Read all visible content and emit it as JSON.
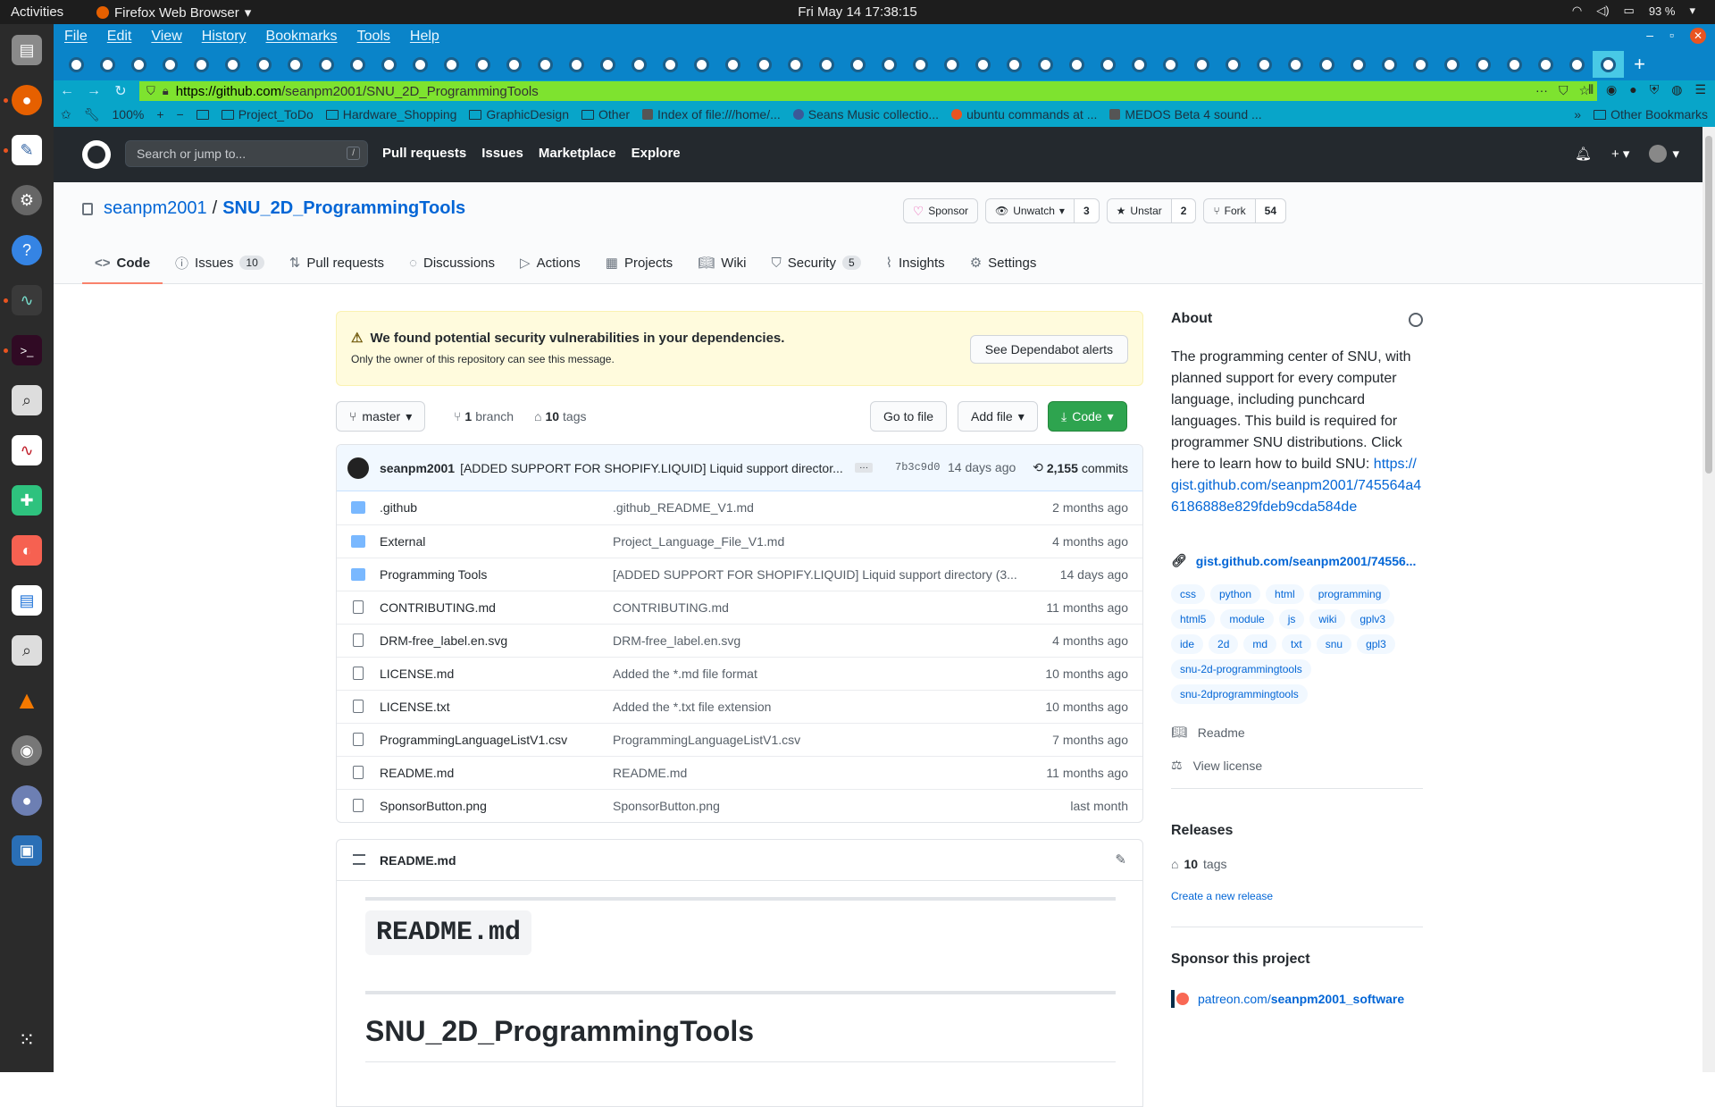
{
  "desktop": {
    "activities": "Activities",
    "app_name": "Firefox Web Browser",
    "clock": "Fri May 14  17:38:15",
    "battery": "93 %"
  },
  "menu": [
    "File",
    "Edit",
    "View",
    "History",
    "Bookmarks",
    "Tools",
    "Help"
  ],
  "url": {
    "domain": "https://github.com",
    "path": "/seanpm2001/SNU_2D_ProgrammingTools"
  },
  "bookmarks": {
    "zoom": "100%",
    "items": [
      "Project_ToDo",
      "Hardware_Shopping",
      "GraphicDesign",
      "Other",
      "Index of file:///home/...",
      "Seans Music collectio...",
      "ubuntu commands at ...",
      "MEDOS Beta 4 sound ..."
    ],
    "other": "Other Bookmarks"
  },
  "gh": {
    "search_placeholder": "Search or jump to...",
    "nav": [
      "Pull requests",
      "Issues",
      "Marketplace",
      "Explore"
    ]
  },
  "repo": {
    "owner": "seanpm2001",
    "name": "SNU_2D_ProgrammingTools",
    "sponsor": "Sponsor",
    "unwatch": "Unwatch",
    "watch_count": "3",
    "unstar": "Unstar",
    "star_count": "2",
    "fork": "Fork",
    "fork_count": "54",
    "tabs": [
      {
        "label": "Code",
        "count": ""
      },
      {
        "label": "Issues",
        "count": "10"
      },
      {
        "label": "Pull requests",
        "count": ""
      },
      {
        "label": "Discussions",
        "count": ""
      },
      {
        "label": "Actions",
        "count": ""
      },
      {
        "label": "Projects",
        "count": ""
      },
      {
        "label": "Wiki",
        "count": ""
      },
      {
        "label": "Security",
        "count": "5"
      },
      {
        "label": "Insights",
        "count": ""
      },
      {
        "label": "Settings",
        "count": ""
      }
    ]
  },
  "alert": {
    "title": "We found potential security vulnerabilities in your dependencies.",
    "subtitle": "Only the owner of this repository can see this message.",
    "button": "See Dependabot alerts"
  },
  "branchbar": {
    "branch": "master",
    "branch_count": "1",
    "branch_label": "branch",
    "tag_count": "10",
    "tag_label": "tags",
    "go_to_file": "Go to file",
    "add_file": "Add file",
    "code": "Code"
  },
  "commit": {
    "author": "seanpm2001",
    "message": "[ADDED SUPPORT FOR SHOPIFY.LIQUID] Liquid support director...",
    "sha": "7b3c9d0",
    "ago": "14 days ago",
    "count": "2,155",
    "count_label": "commits"
  },
  "files": [
    {
      "name": ".github",
      "type": "dir",
      "commit": ".github_README_V1.md",
      "time": "2 months ago"
    },
    {
      "name": "External",
      "type": "dir",
      "commit": "Project_Language_File_V1.md",
      "time": "4 months ago"
    },
    {
      "name": "Programming Tools",
      "type": "dir",
      "commit": "[ADDED SUPPORT FOR SHOPIFY.LIQUID] Liquid support directory (3...",
      "time": "14 days ago"
    },
    {
      "name": "CONTRIBUTING.md",
      "type": "file",
      "commit": "CONTRIBUTING.md",
      "time": "11 months ago"
    },
    {
      "name": "DRM-free_label.en.svg",
      "type": "file",
      "commit": "DRM-free_label.en.svg",
      "time": "4 months ago"
    },
    {
      "name": "LICENSE.md",
      "type": "file",
      "commit": "Added the *.md file format",
      "time": "10 months ago"
    },
    {
      "name": "LICENSE.txt",
      "type": "file",
      "commit": "Added the *.txt file extension",
      "time": "10 months ago"
    },
    {
      "name": "ProgrammingLanguageListV1.csv",
      "type": "file",
      "commit": "ProgrammingLanguageListV1.csv",
      "time": "7 months ago"
    },
    {
      "name": "README.md",
      "type": "file",
      "commit": "README.md",
      "time": "11 months ago"
    },
    {
      "name": "SponsorButton.png",
      "type": "file",
      "commit": "SponsorButton.png",
      "time": "last month"
    }
  ],
  "readme": {
    "header": "README.md",
    "h1_code": "README.md",
    "h1": "SNU_2D_ProgrammingTools"
  },
  "about": {
    "title": "About",
    "description": "The programming center of SNU, with planned support for every computer language, including punchcard languages. This build is required for programmer SNU distributions. Click here to learn how to build SNU:",
    "desc_link": "https://gist.github.com/seanpm2001/745564a46186888e829fdeb9cda584de",
    "website": "gist.github.com/seanpm2001/74556...",
    "topics": [
      "css",
      "python",
      "html",
      "programming",
      "html5",
      "module",
      "js",
      "wiki",
      "gplv3",
      "ide",
      "2d",
      "md",
      "txt",
      "snu",
      "gpl3",
      "snu-2d-programmingtools",
      "snu-2dprogrammingtools"
    ],
    "readme": "Readme",
    "license": "View license"
  },
  "releases": {
    "title": "Releases",
    "tags_count": "10",
    "tags_label": "tags",
    "create": "Create a new release"
  },
  "sponsor": {
    "title": "Sponsor this project",
    "link_prefix": "patreon.com/",
    "link_user": "seanpm2001_software"
  }
}
